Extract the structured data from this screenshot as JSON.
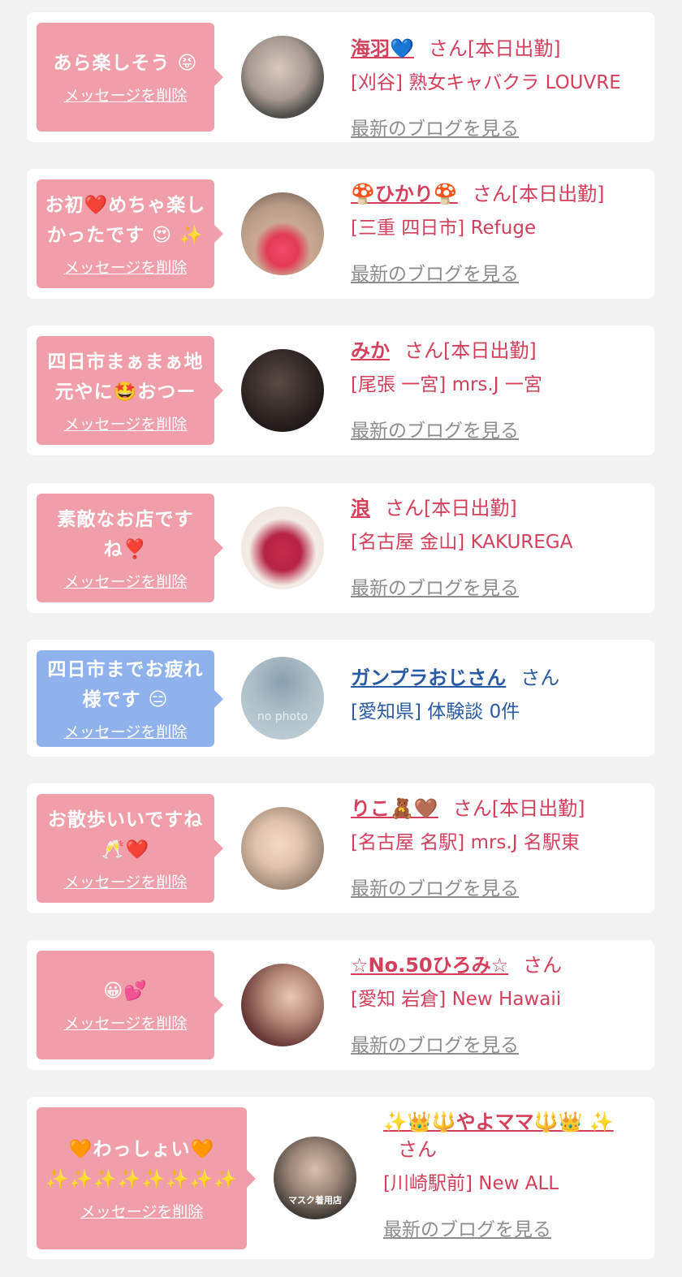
{
  "cards": [
    {
      "message": "あら楽しそう 😝",
      "delete_label": "メッセージを削除",
      "name": "海羽💙",
      "san": "さん[本日出勤]",
      "shop": "[刈谷] 熟女キャバクラ LOUVRE",
      "blog": "最新のブログを見る"
    },
    {
      "message": "お初❤️めちゃ楽しかったです 😍 ✨",
      "delete_label": "メッセージを削除",
      "name": "🍄ひかり🍄",
      "san": "さん[本日出勤]",
      "shop": "[三重 四日市] Refuge",
      "blog": "最新のブログを見る"
    },
    {
      "message": "四日市まぁまぁ地元やに🤩おつー",
      "delete_label": "メッセージを削除",
      "name": "みか",
      "san": "さん[本日出勤]",
      "shop": "[尾張 一宮] mrs.J 一宮",
      "blog": "最新のブログを見る"
    },
    {
      "message": "素敵なお店ですね❣️",
      "delete_label": "メッセージを削除",
      "name": "浪",
      "san": "さん[本日出勤]",
      "shop": "[名古屋 金山] KAKUREGA",
      "blog": "最新のブログを見る"
    },
    {
      "message": "四日市までお疲れ様です 😑",
      "delete_label": "メッセージを削除",
      "name": "ガンプラおじさん",
      "san": "さん",
      "shop": "[愛知県] 体験談 0件",
      "avatar_text": "no photo"
    },
    {
      "message": "お散歩いいですね🥂❤️",
      "delete_label": "メッセージを削除",
      "name": "りこ🧸🤎",
      "san": "さん[本日出勤]",
      "shop": "[名古屋 名駅] mrs.J 名駅東",
      "blog": "最新のブログを見る"
    },
    {
      "message": "😀💕",
      "delete_label": "メッセージを削除",
      "name": "☆No.50ひろみ☆",
      "san": "さん",
      "shop": "[愛知 岩倉] New Hawaii",
      "blog": "最新のブログを見る"
    },
    {
      "message": "🧡わっしょい🧡 ✨✨✨✨✨✨✨✨",
      "delete_label": "メッセージを削除",
      "name": "✨👑🔱やよママ🔱👑 ✨",
      "san": "さん",
      "shop": "[川崎駅前] New ALL",
      "blog": "最新のブログを見る",
      "avatar_text": "マスク着用店"
    }
  ],
  "colors": {
    "bubble_female": "#ef9eaa",
    "bubble_male": "#8fb2ec",
    "female_text": "#d43f5c",
    "male_text": "#2a5aa3",
    "blog_link": "#8d8d8d",
    "page_bg": "#f2f2f2"
  }
}
